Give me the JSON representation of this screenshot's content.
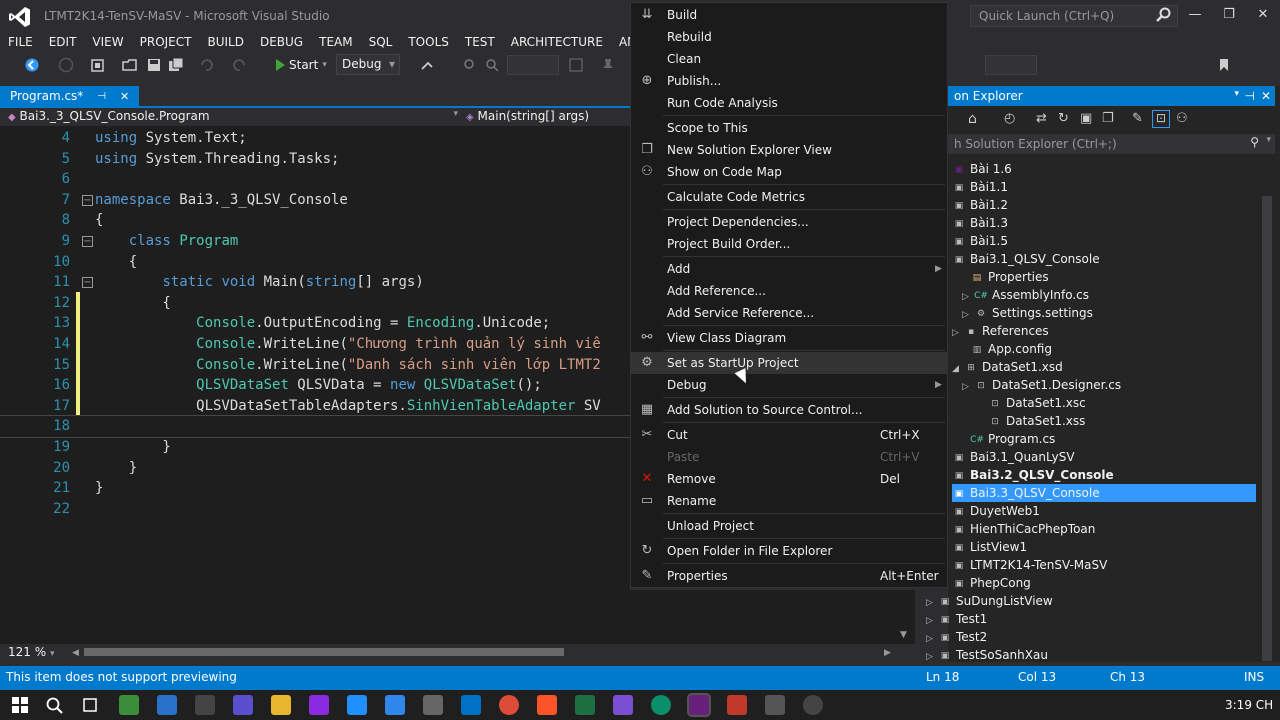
{
  "window": {
    "title": "LTMT2K14-TenSV-MaSV - Microsoft Visual Studio",
    "quick_launch_placeholder": "Quick Launch (Ctrl+Q)"
  },
  "menubar": [
    "FILE",
    "EDIT",
    "VIEW",
    "PROJECT",
    "BUILD",
    "DEBUG",
    "TEAM",
    "SQL",
    "TOOLS",
    "TEST",
    "ARCHITECTURE",
    "ANA"
  ],
  "toolbar": {
    "start_label": "Start",
    "config_value": "Debug"
  },
  "editor": {
    "tab_label": "Program.cs*",
    "nav_left": "Bai3._3_QLSV_Console.Program",
    "nav_right": "Main(string[] args)",
    "zoom": "121 %",
    "lines": [
      {
        "n": "4",
        "text": "using System.Text;"
      },
      {
        "n": "5",
        "text": "using System.Threading.Tasks;"
      },
      {
        "n": "6",
        "text": ""
      },
      {
        "n": "7",
        "text": "namespace Bai3._3_QLSV_Console"
      },
      {
        "n": "8",
        "text": "{"
      },
      {
        "n": "9",
        "text": "    class Program"
      },
      {
        "n": "10",
        "text": "    {"
      },
      {
        "n": "11",
        "text": "        static void Main(string[] args)"
      },
      {
        "n": "12",
        "text": "        {"
      },
      {
        "n": "13",
        "text": "            Console.OutputEncoding = Encoding.Unicode;"
      },
      {
        "n": "14",
        "text": "            Console.WriteLine(\"Chương trình quản lý sinh viê"
      },
      {
        "n": "15",
        "text": "            Console.WriteLine(\"Danh sách sinh viên lớp LTMT2"
      },
      {
        "n": "16",
        "text": "            QLSVDataSet QLSVData = new QLSVDataSet();"
      },
      {
        "n": "17",
        "text": "            QLSVDataSetTableAdapters.SinhVienTableAdapter SV"
      },
      {
        "n": "18",
        "text": ""
      },
      {
        "n": "19",
        "text": "        }"
      },
      {
        "n": "20",
        "text": "    }"
      },
      {
        "n": "21",
        "text": "}"
      },
      {
        "n": "22",
        "text": ""
      }
    ]
  },
  "context_menu": {
    "items": [
      {
        "label": "Build",
        "icon": "build-icon"
      },
      {
        "label": "Rebuild",
        "icon": ""
      },
      {
        "label": "Clean",
        "icon": ""
      },
      {
        "label": "Publish...",
        "icon": "publish-icon"
      },
      {
        "label": "Run Code Analysis",
        "icon": ""
      },
      {
        "label": "Scope to This",
        "icon": ""
      },
      {
        "label": "New Solution Explorer View",
        "icon": "new-view-icon"
      },
      {
        "label": "Show on Code Map",
        "icon": "code-map-icon"
      },
      {
        "label": "Calculate Code Metrics",
        "icon": ""
      },
      {
        "label": "Project Dependencies...",
        "icon": ""
      },
      {
        "label": "Project Build Order...",
        "icon": ""
      },
      {
        "label": "Add",
        "icon": ""
      },
      {
        "label": "Add Reference...",
        "icon": ""
      },
      {
        "label": "Add Service Reference...",
        "icon": ""
      },
      {
        "label": "View Class Diagram",
        "icon": "class-diagram-icon"
      },
      {
        "label": "Set as StartUp Project",
        "icon": "gear-icon"
      },
      {
        "label": "Debug",
        "icon": ""
      },
      {
        "label": "Add Solution to Source Control...",
        "icon": "source-control-icon"
      },
      {
        "label": "Cut",
        "icon": "cut-icon",
        "shortcut": "Ctrl+X"
      },
      {
        "label": "Paste",
        "icon": "",
        "shortcut": "Ctrl+V"
      },
      {
        "label": "Remove",
        "icon": "remove-icon",
        "shortcut": "Del"
      },
      {
        "label": "Rename",
        "icon": "rename-icon"
      },
      {
        "label": "Unload Project",
        "icon": ""
      },
      {
        "label": "Open Folder in File Explorer",
        "icon": "refresh-icon"
      },
      {
        "label": "Properties",
        "icon": "wrench-icon",
        "shortcut": "Alt+Enter"
      }
    ]
  },
  "solution_explorer": {
    "title": "on Explorer",
    "search_placeholder": "h Solution Explorer (Ctrl+;)",
    "items": [
      {
        "label": "Bài 1.6"
      },
      {
        "label": "Bài1.1"
      },
      {
        "label": "Bài1.2"
      },
      {
        "label": "Bài1.3"
      },
      {
        "label": "Bài1.5"
      },
      {
        "label": "Bai3.1_QLSV_Console"
      },
      {
        "label": "Properties"
      },
      {
        "label": "AssemblyInfo.cs"
      },
      {
        "label": "Settings.settings"
      },
      {
        "label": "References"
      },
      {
        "label": "App.config"
      },
      {
        "label": "DataSet1.xsd"
      },
      {
        "label": "DataSet1.Designer.cs"
      },
      {
        "label": "DataSet1.xsc"
      },
      {
        "label": "DataSet1.xss"
      },
      {
        "label": "Program.cs"
      },
      {
        "label": "Bai3.1_QuanLySV"
      },
      {
        "label": "Bai3.2_QLSV_Console"
      },
      {
        "label": "Bai3.3_QLSV_Console"
      },
      {
        "label": "DuyetWeb1"
      },
      {
        "label": "HienThiCacPhepToan"
      },
      {
        "label": "ListView1"
      },
      {
        "label": "LTMT2K14-TenSV-MaSV"
      },
      {
        "label": "PhepCong"
      },
      {
        "label": "SuDungListView"
      },
      {
        "label": "Test1"
      },
      {
        "label": "Test2"
      },
      {
        "label": "TestSoSanhXau"
      }
    ]
  },
  "statusbar": {
    "message": "This item does not support previewing",
    "line": "Ln 18",
    "col": "Col 13",
    "ch": "Ch 13",
    "mode": "INS"
  },
  "taskbar": {
    "clock": "3:19 CH"
  }
}
